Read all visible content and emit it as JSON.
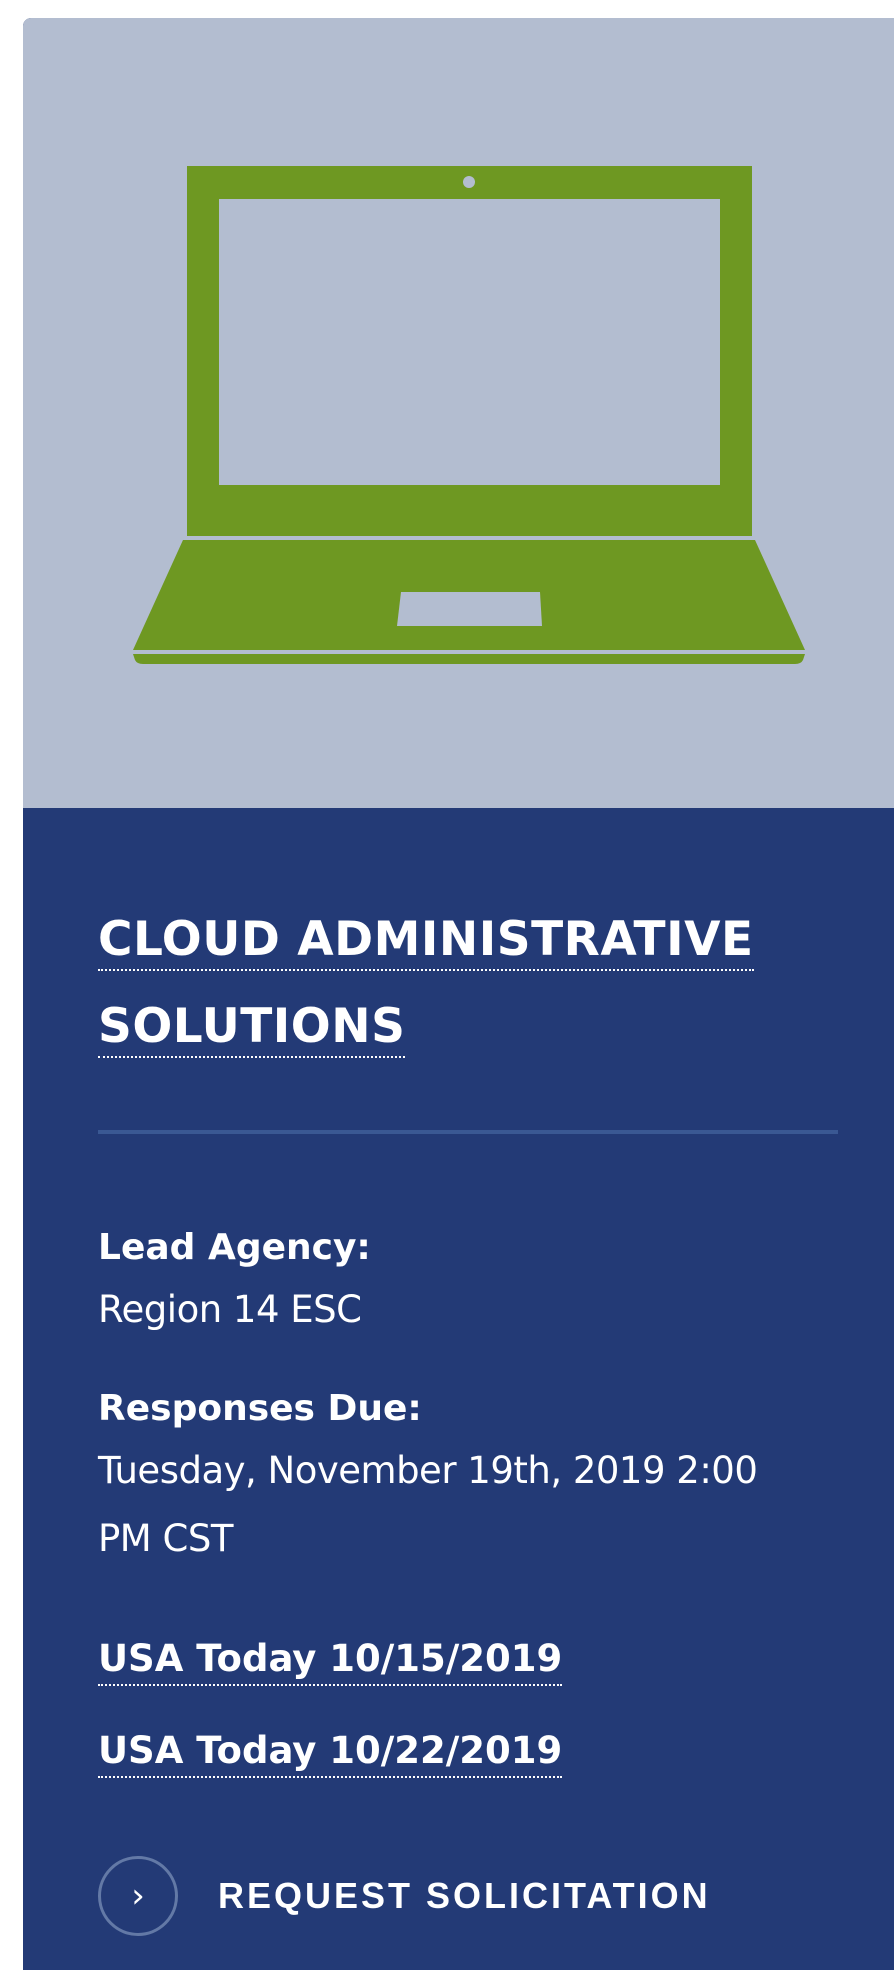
{
  "hero": {
    "icon": "laptop-icon",
    "icon_color": "#6e9822",
    "background": "#b3bdd0"
  },
  "card": {
    "background": "#233a76",
    "title": "CLOUD ADMINISTRATIVE SOLUTIONS",
    "title_line1": "CLOUD ADMINISTRATIVE",
    "title_line2": "SOLUTIONS",
    "lead_agency_label": "Lead Agency:",
    "lead_agency_value": "Region 14 ESC",
    "responses_due_label": "Responses Due:",
    "responses_due_value": "Tuesday, November 19th, 2019 2:00 PM CST",
    "notices": [
      {
        "label": "USA Today 10/15/2019"
      },
      {
        "label": "USA Today 10/22/2019"
      }
    ],
    "request_button": {
      "icon": "chevron-right-icon",
      "label": "REQUEST SOLICITATION"
    }
  }
}
